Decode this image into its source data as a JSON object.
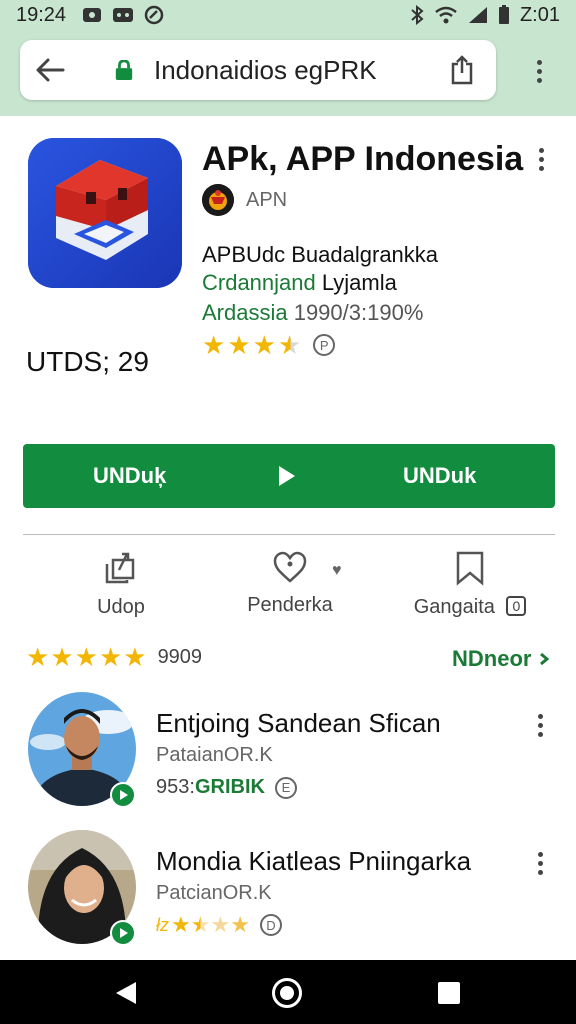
{
  "status_bar": {
    "time": "19:24",
    "clock_right": "Z:01",
    "icons": [
      "screenshot-icon",
      "message-icon",
      "sync-icon",
      "bluetooth-icon",
      "wifi-icon",
      "signal-icon",
      "battery-icon"
    ]
  },
  "browser": {
    "url": "Indonaidios egPRK",
    "icons": [
      "back-arrow-icon",
      "lock-icon",
      "share-icon",
      "more-vert-icon"
    ]
  },
  "app": {
    "title": "APk, APP Indonesia",
    "developer": "APN",
    "line1": "APBUdc Buadalgrankka",
    "line2_green": "Crdannjand",
    "line2_dark": " Lyjamla",
    "line3_green": "Ardassia",
    "line3_grey": " 1990/3:190%",
    "rating_stars": 3.5,
    "rating_icon": "P",
    "utds": "UTDS; 29"
  },
  "install_button": {
    "left_label": "UNDuķ",
    "right_label": "UNDuk",
    "color": "#128c3e"
  },
  "actions": [
    {
      "label": "Udop",
      "icon": "share-stack-icon"
    },
    {
      "label": "Penderka",
      "icon": "heart-icon"
    },
    {
      "label": "Gangaita",
      "icon": "bookmark-icon",
      "badge": "0"
    }
  ],
  "rating_summary": {
    "stars": 5,
    "count": "9909",
    "more_label": "NDneor"
  },
  "reviews": [
    {
      "name": "Entjoing Sandean Sfican",
      "sub": "PataianOR.K",
      "meta_prefix": "953: ",
      "meta_green": "GRIBIK",
      "meta_icon": "E"
    },
    {
      "name": "Mondia Kiatleas Pniingarka",
      "sub": "PatcianOR.K",
      "stars_prefix": "łz",
      "stars": 3.5,
      "meta_icon": "D"
    }
  ],
  "colors": {
    "accent_green": "#128c3e",
    "text_green": "#1b7a36",
    "star": "#f2b705",
    "app_icon_bg": "#1e45cf",
    "header_bg": "#c8e6cf"
  }
}
